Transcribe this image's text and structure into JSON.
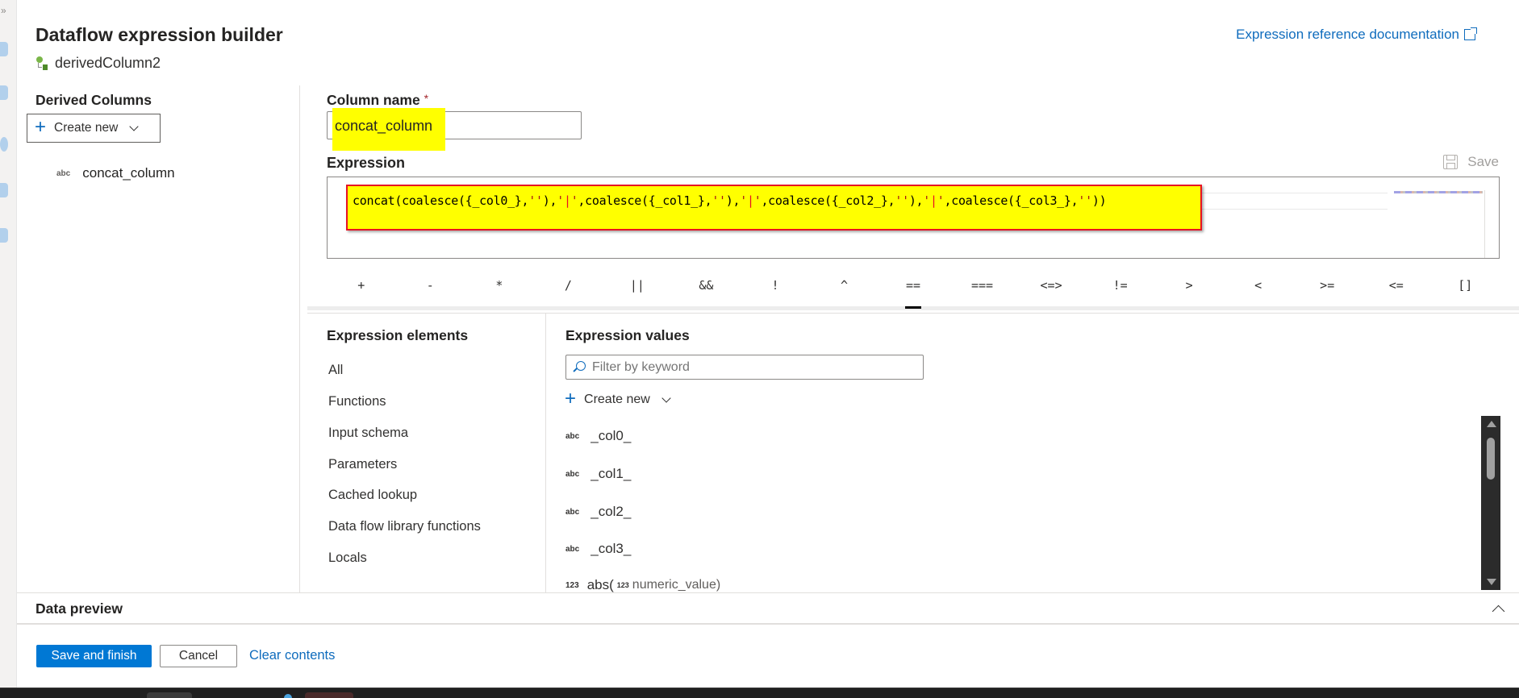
{
  "header": {
    "title": "Dataflow expression builder",
    "node_name": "derivedColumn2",
    "doc_link": "Expression reference documentation"
  },
  "derived_columns": {
    "title": "Derived Columns",
    "create_new_label": "Create new",
    "items": [
      {
        "type_badge": "abc",
        "name": "concat_column"
      }
    ]
  },
  "column_name": {
    "label": "Column name",
    "required_mark": "*",
    "value": "concat_column"
  },
  "expression": {
    "label": "Expression",
    "save_label": "Save",
    "code_segments": [
      {
        "t": "concat(coalesce({_col0_},",
        "c": "plain"
      },
      {
        "t": "''",
        "c": "str"
      },
      {
        "t": "),",
        "c": "plain"
      },
      {
        "t": "'",
        "c": "str"
      },
      {
        "t": "|",
        "c": "pipe"
      },
      {
        "t": "'",
        "c": "str"
      },
      {
        "t": ",coalesce({_col1_},",
        "c": "plain"
      },
      {
        "t": "''",
        "c": "str"
      },
      {
        "t": "),",
        "c": "plain"
      },
      {
        "t": "'",
        "c": "str"
      },
      {
        "t": "|",
        "c": "pipe"
      },
      {
        "t": "'",
        "c": "str"
      },
      {
        "t": ",coalesce({_col2_},",
        "c": "plain"
      },
      {
        "t": "''",
        "c": "str"
      },
      {
        "t": "),",
        "c": "plain"
      },
      {
        "t": "'",
        "c": "str"
      },
      {
        "t": "|",
        "c": "pipe"
      },
      {
        "t": "'",
        "c": "str"
      },
      {
        "t": ",coalesce({_col3_},",
        "c": "plain"
      },
      {
        "t": "''",
        "c": "str"
      },
      {
        "t": "))",
        "c": "plain"
      }
    ],
    "operators": [
      "+",
      "-",
      "*",
      "/",
      "||",
      "&&",
      "!",
      "^",
      "==",
      "===",
      "<=>",
      "!=",
      ">",
      "<",
      ">=",
      "<=",
      "[]"
    ]
  },
  "expression_elements": {
    "title": "Expression elements",
    "items": [
      "All",
      "Functions",
      "Input schema",
      "Parameters",
      "Cached lookup",
      "Data flow library functions",
      "Locals"
    ]
  },
  "expression_values": {
    "title": "Expression values",
    "filter_placeholder": "Filter by keyword",
    "create_new_label": "Create new",
    "items": [
      {
        "badge": "abc",
        "name": "_col0_"
      },
      {
        "badge": "abc",
        "name": "_col1_"
      },
      {
        "badge": "abc",
        "name": "_col2_"
      },
      {
        "badge": "abc",
        "name": "_col3_"
      },
      {
        "badge": "123",
        "name": "abs(",
        "arg_badge": "123",
        "arg": "numeric_value)"
      }
    ]
  },
  "data_preview": {
    "title": "Data preview"
  },
  "footer": {
    "save_finish_label": "Save and finish",
    "cancel_label": "Cancel",
    "clear_label": "Clear contents"
  },
  "colors": {
    "accent": "#0078d4",
    "link": "#0f6cbd",
    "highlight": "#ffff00",
    "annotation_border": "#e81123"
  }
}
